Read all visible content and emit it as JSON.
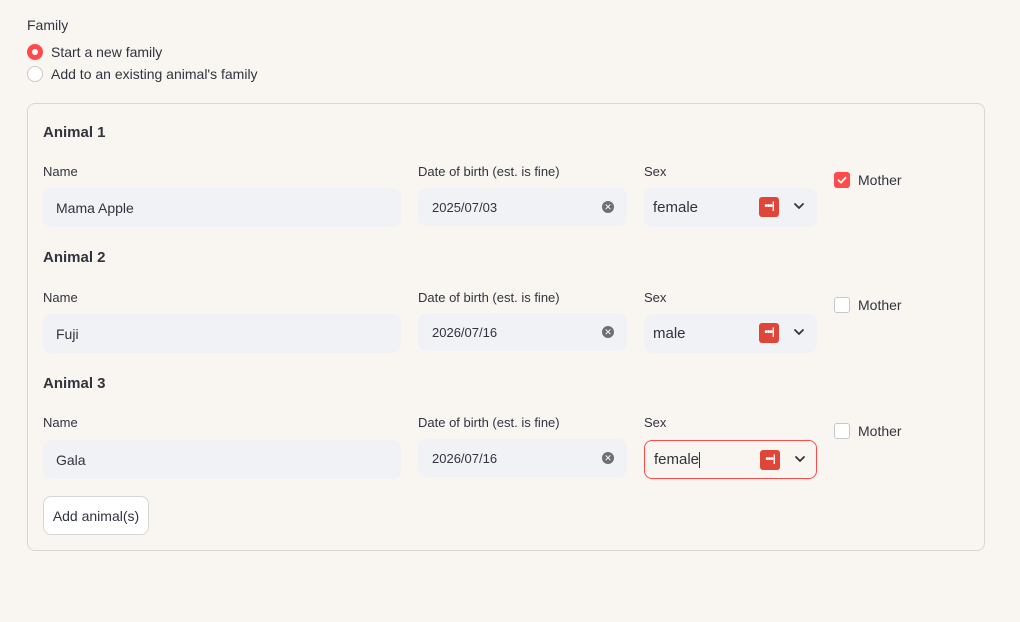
{
  "family": {
    "label": "Family",
    "options": [
      {
        "label": "Start a new family",
        "selected": true
      },
      {
        "label": "Add to an existing animal's family",
        "selected": false
      }
    ]
  },
  "animals": [
    {
      "title": "Animal 1",
      "name_label": "Name",
      "name": "Mama Apple",
      "dob_label": "Date of birth (est. is fine)",
      "dob": "2025/07/03",
      "sex_label": "Sex",
      "sex": "female",
      "mother_label": "Mother",
      "mother": true
    },
    {
      "title": "Animal 2",
      "name_label": "Name",
      "name": "Fuji",
      "dob_label": "Date of birth (est. is fine)",
      "dob": "2026/07/16",
      "sex_label": "Sex",
      "sex": "male",
      "mother_label": "Mother",
      "mother": false
    },
    {
      "title": "Animal 3",
      "name_label": "Name",
      "name": "Gala",
      "dob_label": "Date of birth (est. is fine)",
      "dob": "2026/07/16",
      "sex_label": "Sex",
      "sex": "female",
      "mother_label": "Mother",
      "mother": false
    }
  ],
  "add_button": "Add animal(s)",
  "colors": {
    "accent": "#ff4b4b",
    "input_bg": "#f0f2f6",
    "page_bg": "#f9f6f1"
  }
}
